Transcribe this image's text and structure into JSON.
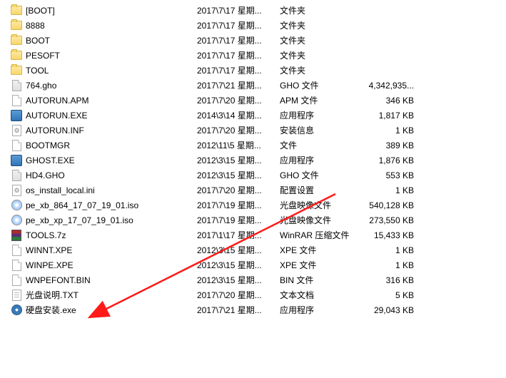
{
  "files": [
    {
      "name": "[BOOT]",
      "date": "2017\\7\\17  星期...",
      "type": "文件夹",
      "size": "",
      "icon": "folder"
    },
    {
      "name": "8888",
      "date": "2017\\7\\17  星期...",
      "type": "文件夹",
      "size": "",
      "icon": "folder"
    },
    {
      "name": "BOOT",
      "date": "2017\\7\\17  星期...",
      "type": "文件夹",
      "size": "",
      "icon": "folder"
    },
    {
      "name": "PESOFT",
      "date": "2017\\7\\17  星期...",
      "type": "文件夹",
      "size": "",
      "icon": "folder"
    },
    {
      "name": "TOOL",
      "date": "2017\\7\\17  星期...",
      "type": "文件夹",
      "size": "",
      "icon": "folder"
    },
    {
      "name": "764.gho",
      "date": "2017\\7\\21  星期...",
      "type": "GHO 文件",
      "size": "4,342,935...",
      "icon": "gho"
    },
    {
      "name": "AUTORUN.APM",
      "date": "2017\\7\\20  星期...",
      "type": "APM 文件",
      "size": "346 KB",
      "icon": "file"
    },
    {
      "name": "AUTORUN.EXE",
      "date": "2014\\3\\14  星期...",
      "type": "应用程序",
      "size": "1,817 KB",
      "icon": "exe"
    },
    {
      "name": "AUTORUN.INF",
      "date": "2017\\7\\20  星期...",
      "type": "安装信息",
      "size": "1 KB",
      "icon": "inf"
    },
    {
      "name": "BOOTMGR",
      "date": "2012\\11\\5  星期...",
      "type": "文件",
      "size": "389 KB",
      "icon": "file"
    },
    {
      "name": "GHOST.EXE",
      "date": "2012\\3\\15  星期...",
      "type": "应用程序",
      "size": "1,876 KB",
      "icon": "exe"
    },
    {
      "name": "HD4.GHO",
      "date": "2012\\3\\15  星期...",
      "type": "GHO 文件",
      "size": "553 KB",
      "icon": "gho"
    },
    {
      "name": "os_install_local.ini",
      "date": "2017\\7\\20  星期...",
      "type": "配置设置",
      "size": "1 KB",
      "icon": "inf"
    },
    {
      "name": "pe_xb_864_17_07_19_01.iso",
      "date": "2017\\7\\19  星期...",
      "type": "光盘映像文件",
      "size": "540,128 KB",
      "icon": "disc"
    },
    {
      "name": "pe_xb_xp_17_07_19_01.iso",
      "date": "2017\\7\\19  星期...",
      "type": "光盘映像文件",
      "size": "273,550 KB",
      "icon": "disc"
    },
    {
      "name": "TOOLS.7z",
      "date": "2017\\1\\17  星期...",
      "type": "WinRAR 压缩文件",
      "size": "15,433 KB",
      "icon": "rar"
    },
    {
      "name": "WINNT.XPE",
      "date": "2012\\3\\15  星期...",
      "type": "XPE 文件",
      "size": "1 KB",
      "icon": "file"
    },
    {
      "name": "WINPE.XPE",
      "date": "2012\\3\\15  星期...",
      "type": "XPE 文件",
      "size": "1 KB",
      "icon": "file"
    },
    {
      "name": "WNPEFONT.BIN",
      "date": "2012\\3\\15  星期...",
      "type": "BIN 文件",
      "size": "316 KB",
      "icon": "file"
    },
    {
      "name": "光盘说明.TXT",
      "date": "2017\\7\\20  星期...",
      "type": "文本文档",
      "size": "5 KB",
      "icon": "txt"
    },
    {
      "name": "硬盘安装.exe",
      "date": "2017\\7\\21  星期...",
      "type": "应用程序",
      "size": "29,043 KB",
      "icon": "install"
    }
  ],
  "annotation": {
    "color": "#ff1a1a"
  }
}
